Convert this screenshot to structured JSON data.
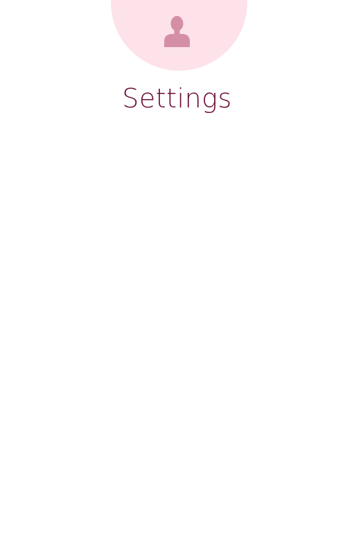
{
  "header": {
    "title": "Settings",
    "avatar_icon": "user-icon"
  },
  "colors": {
    "avatar_background": "#fde2ea",
    "avatar_icon": "#d48fa6",
    "title_text": "#6b0f3a",
    "page_background": "#ffffff"
  }
}
